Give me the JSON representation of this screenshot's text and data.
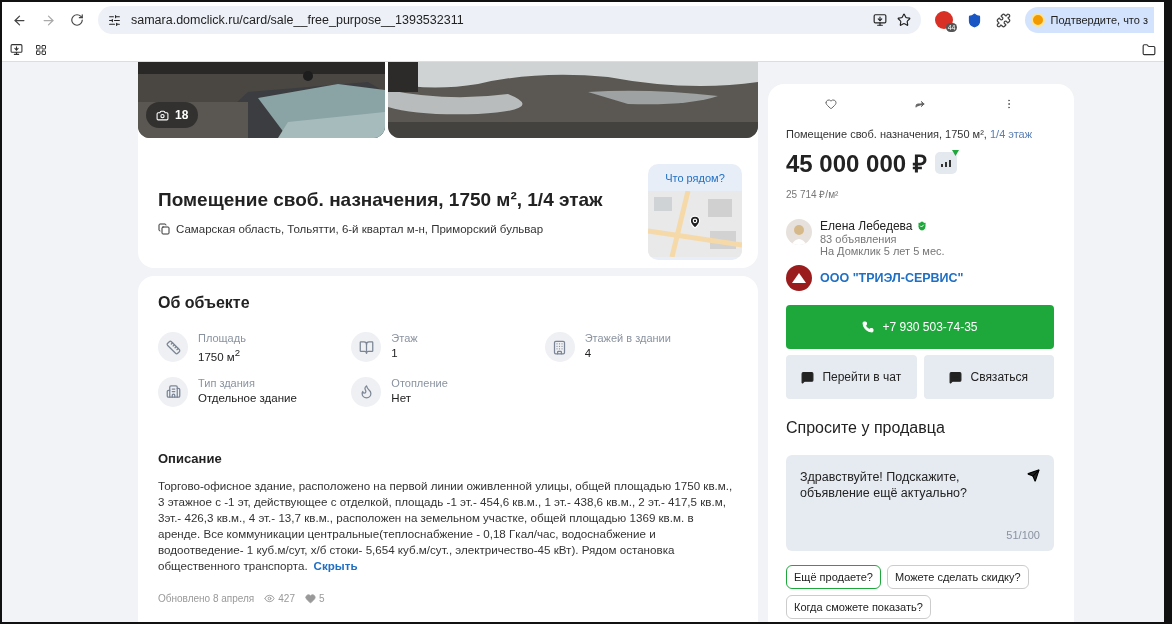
{
  "browser": {
    "url": "samara.domclick.ru/card/sale__free_purpose__1393532311",
    "extension_badge": "44",
    "profile_prompt": "Подтвердите, что з"
  },
  "listing": {
    "photo_count": "18",
    "title": "Помещение своб. назначения, 1750 м², 1/4 этаж",
    "address": "Самарская область, Тольятти, 6-й квартал м-н, Приморский бульвар",
    "map_button": "Что рядом?"
  },
  "about": {
    "heading": "Об объекте",
    "features": [
      {
        "kind": "area",
        "label": "Площадь",
        "value": "1750 м$^{2}$"
      },
      {
        "kind": "floor",
        "label": "Этаж",
        "value": "1"
      },
      {
        "kind": "floors",
        "label": "Этажей в здании",
        "value": "4"
      },
      {
        "kind": "building",
        "label": "Тип здания",
        "value": "Отдельное здание"
      },
      {
        "kind": "heating",
        "label": "Отопление",
        "value": "Нет"
      }
    ]
  },
  "description": {
    "heading": "Описание",
    "text": "Торгово-офисное здание, расположено на первой линии оживленной улицы, общей площадью 1750 кв.м., 3 этажное с -1 эт, действующее с отделкой, площадь -1 эт.- 454,6 кв.м., 1 эт.- 438,6 кв.м., 2 эт.- 417,5 кв.м, 3эт.- 426,3 кв.м., 4 эт.- 13,7 кв.м., расположен на земельном участке, общей площадью 1369 кв.м. в аренде. Все коммуникации центральные(теплоснабжение - 0,18 Гкал/час, водоснабжение и водоотведение- 1 куб.м/сут, х/б стоки- 5,654 куб.м/сут., электричество-45 кВт). Рядом остановка общественного транспорта.",
    "toggle": "Скрыть"
  },
  "footer": {
    "updated": "Обновлено 8 апреля",
    "views": "427",
    "favorites": "5"
  },
  "sidebar": {
    "title": "Помещение своб. назначения, 1750 м²,",
    "floor_link": "1/4 этаж",
    "price": "45 000 000 ₽",
    "price_per_m2": "25 714 ₽/м²",
    "agent": {
      "name": "Елена Лебедева",
      "verified": true,
      "listings": "83 объявления",
      "tenure": "На Домклик 5 лет 5 мес."
    },
    "company": "ООО \"ТРИЭЛ-СЕРВИС\"",
    "phone": "+7 930 503-74-35",
    "chat_button": "Перейти в чат",
    "contact_button": "Связаться",
    "ask_heading": "Спросите у продавца",
    "message": "Здравствуйте! Подскажите, объявление ещё актуально?",
    "counter": "51/100",
    "quick_replies": [
      {
        "label": "Ещё продаете?",
        "selected": true
      },
      {
        "label": "Можете сделать скидку?",
        "selected": false
      },
      {
        "label": "Когда сможете показать?",
        "selected": false
      }
    ]
  }
}
